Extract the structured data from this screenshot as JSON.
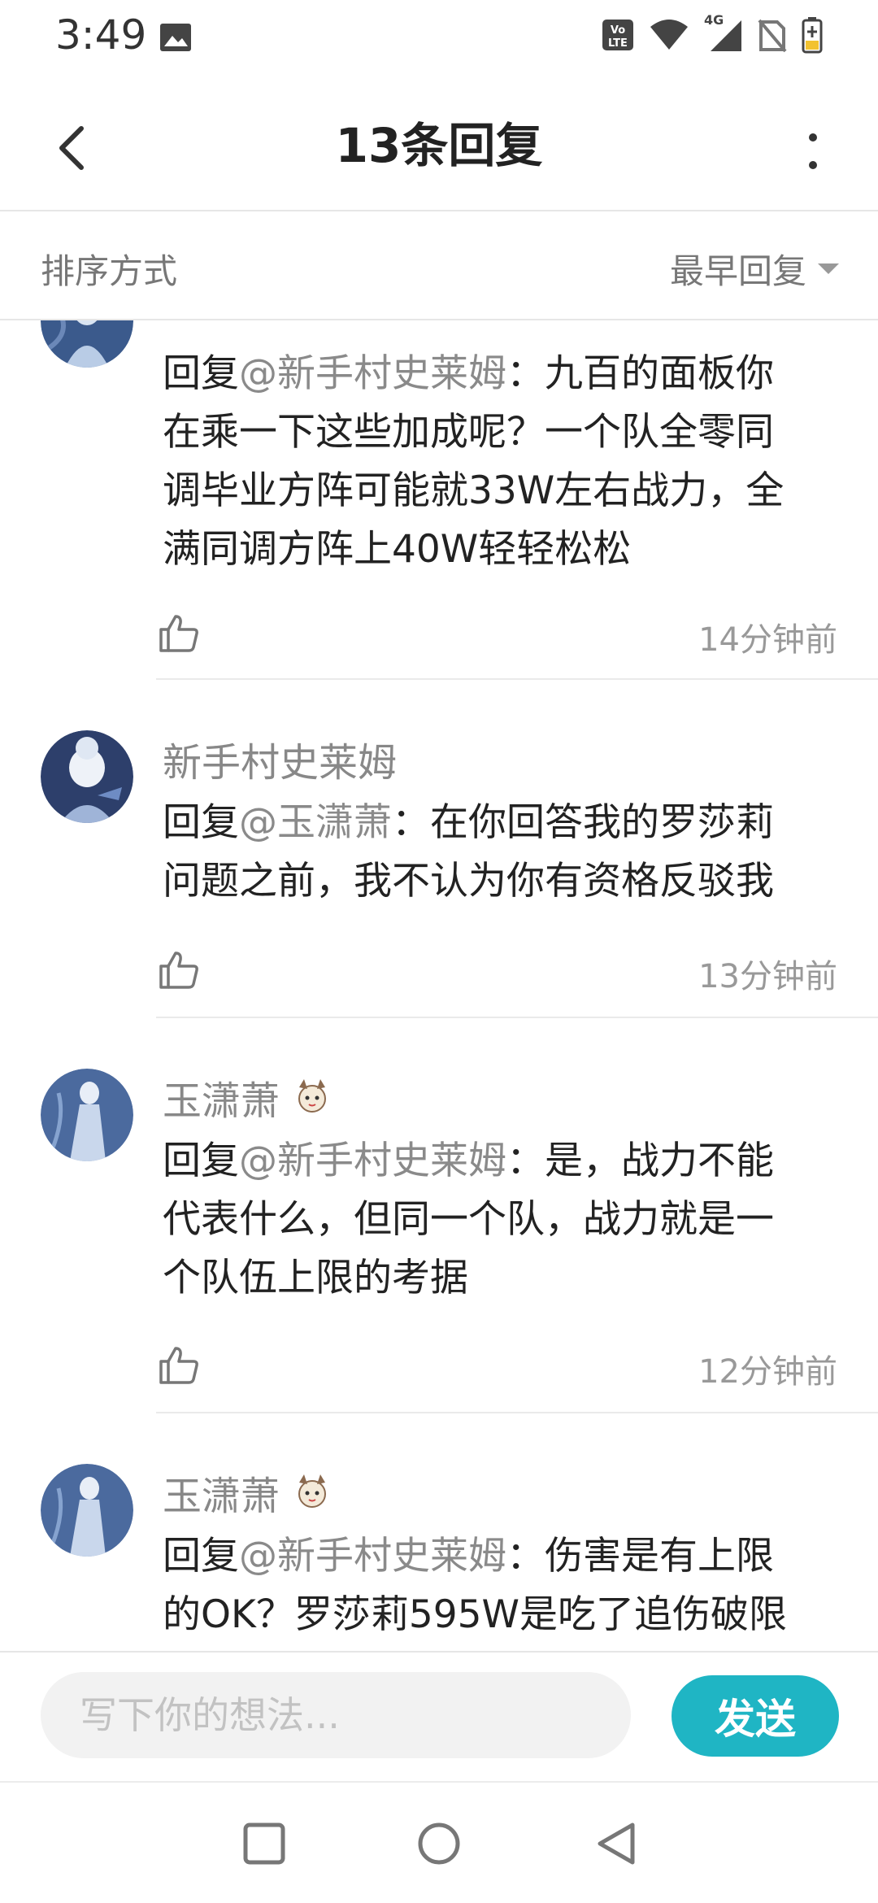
{
  "status_bar": {
    "time": "3:49",
    "network": "4G"
  },
  "header": {
    "title": "13条回复"
  },
  "sort": {
    "label": "排序方式",
    "selected": "最早回复"
  },
  "replies": [
    {
      "name": "",
      "has_badge": false,
      "prefix": "回复",
      "mention": "@新手村史莱姆",
      "body_lines": [
        "：九百的面板你",
        "在乘一下这些加成呢？一个队全零同",
        "调毕业方阵可能就33W左右战力，全",
        "满同调方阵上40W轻轻松松"
      ],
      "time": "14分钟前"
    },
    {
      "name": "新手村史莱姆",
      "has_badge": false,
      "prefix": "回复",
      "mention": "@玉潇萧",
      "body_lines": [
        "：在你回答我的罗莎莉",
        "问题之前，我不认为你有资格反驳我"
      ],
      "time": "13分钟前"
    },
    {
      "name": "玉潇萧",
      "has_badge": true,
      "prefix": "回复",
      "mention": "@新手村史莱姆",
      "body_lines": [
        "：是，战力不能",
        "代表什么，但同一个队，战力就是一",
        "个队伍上限的考据"
      ],
      "time": "12分钟前"
    },
    {
      "name": "玉潇萧",
      "has_badge": true,
      "prefix": "回复",
      "mention": "@新手村史莱姆",
      "body_lines": [
        "：伤害是有上限",
        "的OK？罗莎莉595W是吃了追伤破限"
      ],
      "time": ""
    }
  ],
  "composer": {
    "placeholder": "写下你的想法...",
    "send_label": "发送"
  },
  "colors": {
    "accent": "#1fb5c4",
    "mention": "#8a8a8a",
    "muted": "#999999"
  },
  "icons": [
    "back-arrow-icon",
    "more-vertical-icon",
    "sort-caret-icon",
    "thumb-up-icon",
    "nav-square-icon",
    "nav-circle-icon",
    "nav-back-triangle-icon"
  ]
}
